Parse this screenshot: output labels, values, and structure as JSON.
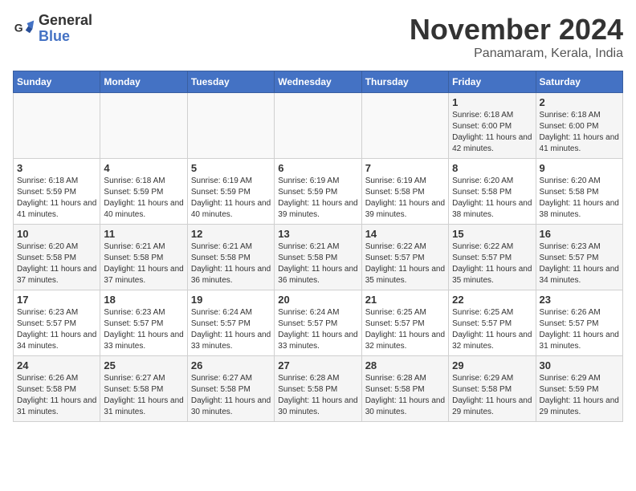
{
  "header": {
    "logo_line1": "General",
    "logo_line2": "Blue",
    "title": "November 2024",
    "subtitle": "Panamaram, Kerala, India"
  },
  "weekdays": [
    "Sunday",
    "Monday",
    "Tuesday",
    "Wednesday",
    "Thursday",
    "Friday",
    "Saturday"
  ],
  "weeks": [
    [
      {
        "day": "",
        "info": ""
      },
      {
        "day": "",
        "info": ""
      },
      {
        "day": "",
        "info": ""
      },
      {
        "day": "",
        "info": ""
      },
      {
        "day": "",
        "info": ""
      },
      {
        "day": "1",
        "info": "Sunrise: 6:18 AM\nSunset: 6:00 PM\nDaylight: 11 hours and 42 minutes."
      },
      {
        "day": "2",
        "info": "Sunrise: 6:18 AM\nSunset: 6:00 PM\nDaylight: 11 hours and 41 minutes."
      }
    ],
    [
      {
        "day": "3",
        "info": "Sunrise: 6:18 AM\nSunset: 5:59 PM\nDaylight: 11 hours and 41 minutes."
      },
      {
        "day": "4",
        "info": "Sunrise: 6:18 AM\nSunset: 5:59 PM\nDaylight: 11 hours and 40 minutes."
      },
      {
        "day": "5",
        "info": "Sunrise: 6:19 AM\nSunset: 5:59 PM\nDaylight: 11 hours and 40 minutes."
      },
      {
        "day": "6",
        "info": "Sunrise: 6:19 AM\nSunset: 5:59 PM\nDaylight: 11 hours and 39 minutes."
      },
      {
        "day": "7",
        "info": "Sunrise: 6:19 AM\nSunset: 5:58 PM\nDaylight: 11 hours and 39 minutes."
      },
      {
        "day": "8",
        "info": "Sunrise: 6:20 AM\nSunset: 5:58 PM\nDaylight: 11 hours and 38 minutes."
      },
      {
        "day": "9",
        "info": "Sunrise: 6:20 AM\nSunset: 5:58 PM\nDaylight: 11 hours and 38 minutes."
      }
    ],
    [
      {
        "day": "10",
        "info": "Sunrise: 6:20 AM\nSunset: 5:58 PM\nDaylight: 11 hours and 37 minutes."
      },
      {
        "day": "11",
        "info": "Sunrise: 6:21 AM\nSunset: 5:58 PM\nDaylight: 11 hours and 37 minutes."
      },
      {
        "day": "12",
        "info": "Sunrise: 6:21 AM\nSunset: 5:58 PM\nDaylight: 11 hours and 36 minutes."
      },
      {
        "day": "13",
        "info": "Sunrise: 6:21 AM\nSunset: 5:58 PM\nDaylight: 11 hours and 36 minutes."
      },
      {
        "day": "14",
        "info": "Sunrise: 6:22 AM\nSunset: 5:57 PM\nDaylight: 11 hours and 35 minutes."
      },
      {
        "day": "15",
        "info": "Sunrise: 6:22 AM\nSunset: 5:57 PM\nDaylight: 11 hours and 35 minutes."
      },
      {
        "day": "16",
        "info": "Sunrise: 6:23 AM\nSunset: 5:57 PM\nDaylight: 11 hours and 34 minutes."
      }
    ],
    [
      {
        "day": "17",
        "info": "Sunrise: 6:23 AM\nSunset: 5:57 PM\nDaylight: 11 hours and 34 minutes."
      },
      {
        "day": "18",
        "info": "Sunrise: 6:23 AM\nSunset: 5:57 PM\nDaylight: 11 hours and 33 minutes."
      },
      {
        "day": "19",
        "info": "Sunrise: 6:24 AM\nSunset: 5:57 PM\nDaylight: 11 hours and 33 minutes."
      },
      {
        "day": "20",
        "info": "Sunrise: 6:24 AM\nSunset: 5:57 PM\nDaylight: 11 hours and 33 minutes."
      },
      {
        "day": "21",
        "info": "Sunrise: 6:25 AM\nSunset: 5:57 PM\nDaylight: 11 hours and 32 minutes."
      },
      {
        "day": "22",
        "info": "Sunrise: 6:25 AM\nSunset: 5:57 PM\nDaylight: 11 hours and 32 minutes."
      },
      {
        "day": "23",
        "info": "Sunrise: 6:26 AM\nSunset: 5:57 PM\nDaylight: 11 hours and 31 minutes."
      }
    ],
    [
      {
        "day": "24",
        "info": "Sunrise: 6:26 AM\nSunset: 5:58 PM\nDaylight: 11 hours and 31 minutes."
      },
      {
        "day": "25",
        "info": "Sunrise: 6:27 AM\nSunset: 5:58 PM\nDaylight: 11 hours and 31 minutes."
      },
      {
        "day": "26",
        "info": "Sunrise: 6:27 AM\nSunset: 5:58 PM\nDaylight: 11 hours and 30 minutes."
      },
      {
        "day": "27",
        "info": "Sunrise: 6:28 AM\nSunset: 5:58 PM\nDaylight: 11 hours and 30 minutes."
      },
      {
        "day": "28",
        "info": "Sunrise: 6:28 AM\nSunset: 5:58 PM\nDaylight: 11 hours and 30 minutes."
      },
      {
        "day": "29",
        "info": "Sunrise: 6:29 AM\nSunset: 5:58 PM\nDaylight: 11 hours and 29 minutes."
      },
      {
        "day": "30",
        "info": "Sunrise: 6:29 AM\nSunset: 5:59 PM\nDaylight: 11 hours and 29 minutes."
      }
    ]
  ]
}
